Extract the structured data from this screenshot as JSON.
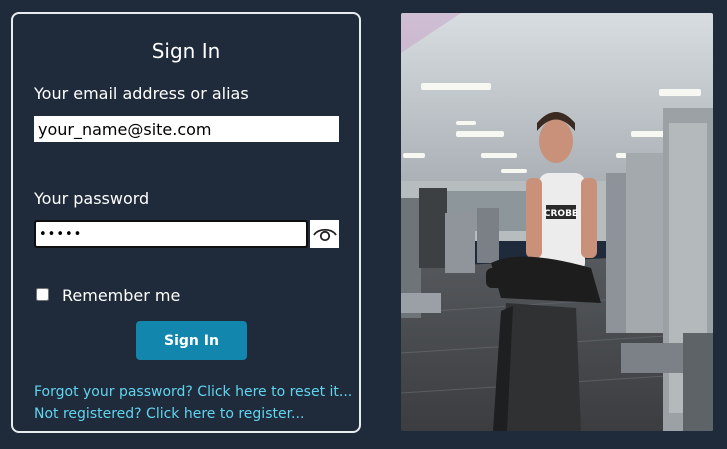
{
  "login": {
    "title": "Sign In",
    "email_label": "Your email address or alias",
    "email_value": "your_name@site.com",
    "password_label": "Your password",
    "password_value": "passw",
    "remember_label": "Remember me",
    "remember_checked": false,
    "submit_label": "Sign In",
    "forgot_link": "Forgot your password? Click here to reset it...",
    "register_link": "Not registered? Click here to register..."
  },
  "photo": {
    "shirt_text": "CROBE"
  },
  "colors": {
    "background": "#1f2a3a",
    "button": "#1286ad",
    "link": "#61d4f0",
    "text": "#ffffff"
  },
  "icons": {
    "password_toggle": "eye-icon"
  }
}
